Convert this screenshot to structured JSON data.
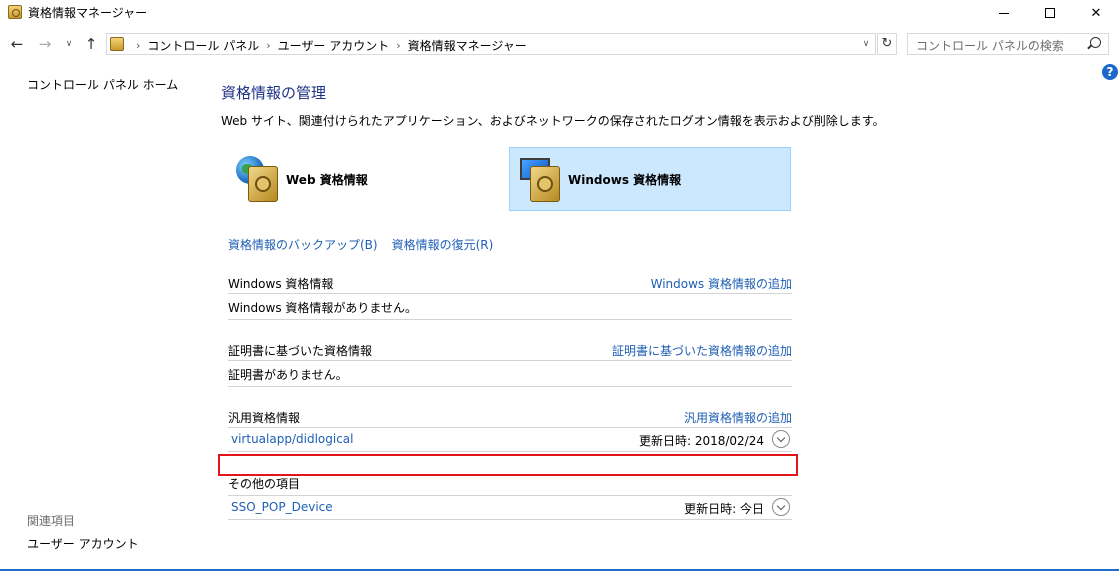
{
  "window": {
    "title": "資格情報マネージャー",
    "minimize_glyph": "—",
    "maximize_glyph": "□",
    "close_glyph": "✕"
  },
  "navigation": {
    "back_glyph": "←",
    "forward_glyph": "→",
    "recent_glyph": "∨",
    "up_glyph": "↑",
    "breadcrumbs": [
      "コントロール パネル",
      "ユーザー アカウント",
      "資格情報マネージャー"
    ],
    "breadcrumb_separator": "›",
    "dropdown_glyph": "∨",
    "refresh_glyph": "↻",
    "search_placeholder": "コントロール パネルの検索"
  },
  "help": {
    "label": "?"
  },
  "left_pane": {
    "home_link": "コントロール パネル ホーム",
    "related_title": "関連項目",
    "related_items": [
      "ユーザー アカウント"
    ]
  },
  "main": {
    "title": "資格情報の管理",
    "description": "Web サイト、関連付けられたアプリケーション、およびネットワークの保存されたログオン情報を表示および削除します。",
    "tiles": [
      {
        "label": "Web 資格情報",
        "selected": false,
        "icon": "web-credentials-icon"
      },
      {
        "label": "Windows 資格情報",
        "selected": true,
        "icon": "windows-credentials-icon"
      }
    ],
    "backup_link": "資格情報のバックアップ(B)",
    "restore_link": "資格情報の復元(R)",
    "sections": [
      {
        "title": "Windows 資格情報",
        "add_link": "Windows 資格情報の追加",
        "empty_text": "Windows 資格情報がありません。",
        "items": []
      },
      {
        "title": "証明書に基づいた資格情報",
        "add_link": "証明書に基づいた資格情報の追加",
        "empty_text": "証明書がありません。",
        "items": []
      },
      {
        "title": "汎用資格情報",
        "add_link": "汎用資格情報の追加",
        "items": [
          {
            "name": "virtualapp/didlogical",
            "modified": "更新日時:  2018/02/24"
          }
        ]
      },
      {
        "title": "その他の項目",
        "items": [
          {
            "name": "SSO_POP_Device",
            "modified": "更新日時:  今日"
          }
        ]
      }
    ]
  },
  "colors": {
    "link": "#1e5fb4",
    "title": "#1e3287",
    "selected_tile_bg": "#cce8ff",
    "highlight_box": "#e0161b",
    "help_icon_bg": "#1b6ac9"
  }
}
